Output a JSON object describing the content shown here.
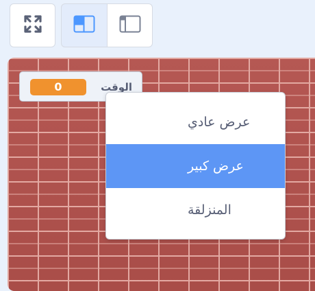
{
  "toolbar": {
    "fullscreen_icon": "fullscreen-icon",
    "small_stage_icon": "small-stage-icon",
    "large_stage_icon": "large-stage-icon",
    "accent": "#4c97ff"
  },
  "monitor": {
    "label": "الوقت",
    "value": "0",
    "value_color": "#f0922e"
  },
  "context_menu": {
    "items": [
      {
        "label": "عرض عادي",
        "selected": false
      },
      {
        "label": "عرض كبير",
        "selected": true
      },
      {
        "label": "المنزلقة",
        "selected": false
      }
    ],
    "highlight_color": "#5d96f5"
  }
}
